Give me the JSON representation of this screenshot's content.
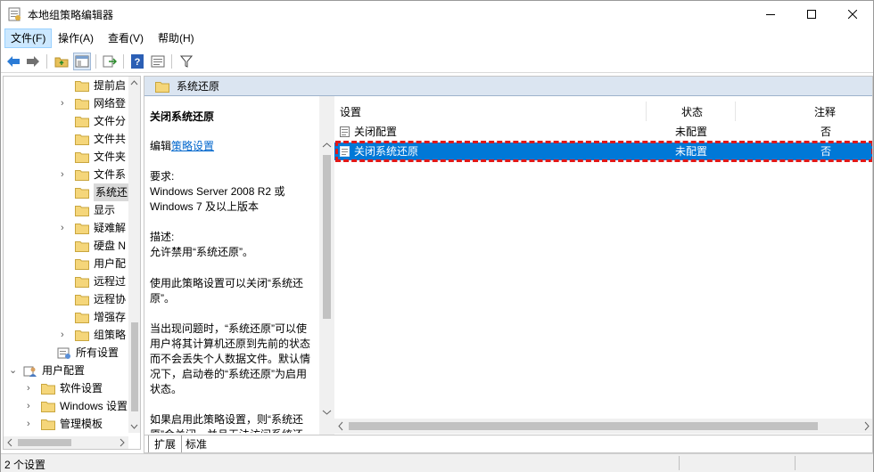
{
  "window": {
    "title": "本地组策略编辑器"
  },
  "menu": [
    "文件(F)",
    "操作(A)",
    "查看(V)",
    "帮助(H)"
  ],
  "tree": [
    {
      "label": "提前启",
      "expand": "",
      "indent": 80
    },
    {
      "label": "网络登",
      "expand": "›",
      "indent": 80
    },
    {
      "label": "文件分",
      "expand": "",
      "indent": 80
    },
    {
      "label": "文件共",
      "expand": "",
      "indent": 80
    },
    {
      "label": "文件夹",
      "expand": "",
      "indent": 80
    },
    {
      "label": "文件系",
      "expand": "›",
      "indent": 80
    },
    {
      "label": "系统还",
      "expand": "",
      "indent": 80,
      "selected": true
    },
    {
      "label": "显示",
      "expand": "",
      "indent": 80
    },
    {
      "label": "疑难解",
      "expand": "›",
      "indent": 80
    },
    {
      "label": "硬盘 N",
      "expand": "",
      "indent": 80
    },
    {
      "label": "用户配",
      "expand": "",
      "indent": 80
    },
    {
      "label": "远程过",
      "expand": "",
      "indent": 80
    },
    {
      "label": "远程协",
      "expand": "",
      "indent": 80
    },
    {
      "label": "增强存",
      "expand": "",
      "indent": 80
    },
    {
      "label": "组策略",
      "expand": "›",
      "indent": 80
    },
    {
      "label": "所有设置",
      "expand": "",
      "indent": 60,
      "icon": "settings"
    },
    {
      "label": "用户配置",
      "expand": "⌄",
      "indent": 22,
      "icon": "user"
    },
    {
      "label": "软件设置",
      "expand": "›",
      "indent": 42
    },
    {
      "label": "Windows 设置",
      "expand": "›",
      "indent": 42
    },
    {
      "label": "管理模板",
      "expand": "›",
      "indent": 42
    }
  ],
  "right_header": "系统还原",
  "description": {
    "title": "关闭系统还原",
    "edit_prefix": "编辑",
    "edit_link": "策略设置",
    "req_label": "要求:",
    "req_text": "Windows Server 2008 R2 或 Windows 7 及以上版本",
    "desc_label": "描述:",
    "desc_text": "允许禁用“系统还原”。",
    "p1": "使用此策略设置可以关闭“系统还原”。",
    "p2": "当出现问题时，“系统还原”可以使用户将其计算机还原到先前的状态而不会丢失个人数据文件。默认情况下，启动卷的“系统还原”为启用状态。",
    "p3": "如果启用此策略设置，则“系统还原”会关闭，并且无法访问系统还"
  },
  "list": {
    "columns": [
      "设置",
      "状态",
      "注释"
    ],
    "rows": [
      {
        "name": "关闭配置",
        "state": "未配置",
        "note": "否",
        "selected": false
      },
      {
        "name": "关闭系统还原",
        "state": "未配置",
        "note": "否",
        "selected": true
      }
    ]
  },
  "tabs": [
    "扩展",
    "标准"
  ],
  "status": {
    "text": "2 个设置"
  },
  "colors": {
    "selection": "#0078d7",
    "highlight_box": "#e01818",
    "header_bg": "#dbe5f1"
  }
}
